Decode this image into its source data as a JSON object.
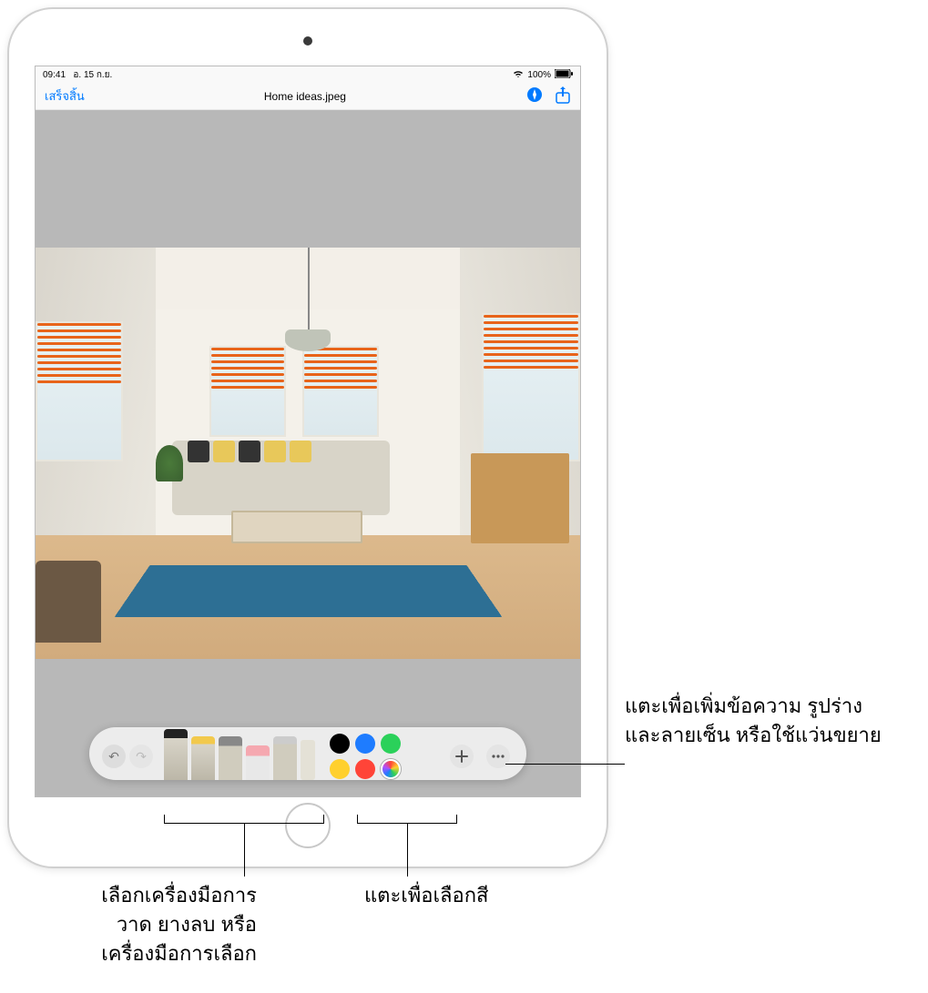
{
  "statusbar": {
    "time": "09:41",
    "date": "อ. 15 ก.ย.",
    "battery": "100%"
  },
  "navbar": {
    "done": "เสร็จสิ้น",
    "title": "Home ideas.jpeg"
  },
  "toolbar": {
    "undo": "↶",
    "redo": "↷",
    "add": "+",
    "more": "⋯",
    "colors": {
      "black": "#000000",
      "blue": "#1e7cff",
      "green": "#2bd15a",
      "yellow": "#ffd02e",
      "red": "#ff4438"
    }
  },
  "callouts": {
    "add": "แตะเพื่อเพิ่มข้อความ รูปร่าง\nและลายเซ็น หรือใช้แว่นขยาย",
    "tools": "เลือกเครื่องมือการ\nวาด ยางลบ หรือ\nเครื่องมือการเลือก",
    "colors": "แตะเพื่อเลือกสี"
  }
}
